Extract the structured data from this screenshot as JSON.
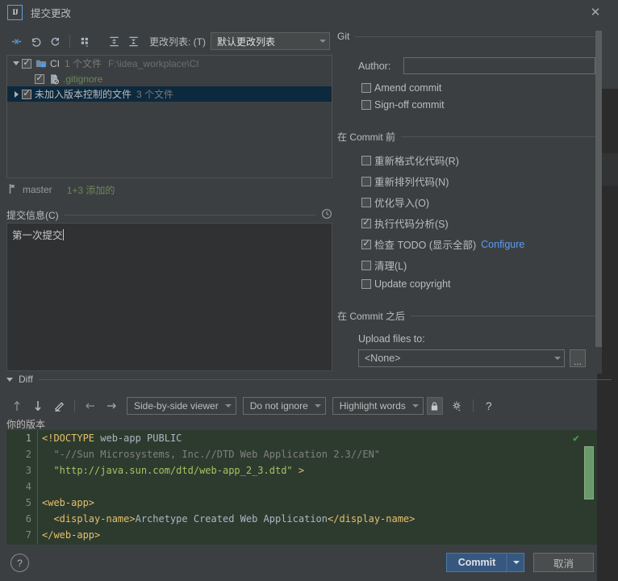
{
  "window": {
    "title": "提交更改",
    "logo_text": "IJ",
    "close_icon": "close-icon"
  },
  "changes_toolbar": {
    "buttons": [
      {
        "name": "show-diff-icon",
        "label": "Show Diff"
      },
      {
        "name": "revert-icon",
        "label": "Revert"
      },
      {
        "name": "refresh-icon",
        "label": "Refresh"
      },
      {
        "name": "group-by-icon",
        "label": "Group By"
      },
      {
        "name": "expand-all-icon",
        "label": "Expand All"
      },
      {
        "name": "collapse-all-icon",
        "label": "Collapse All"
      }
    ],
    "changelist_label": "更改列表: (T)",
    "changelist_value": "默认更改列表"
  },
  "file_tree": {
    "rows": [
      {
        "type": "folder",
        "twisty": "down",
        "checked": true,
        "icon": "folder-icon",
        "name": "CI",
        "sub": "1 个文件",
        "path": "F:\\idea_workplace\\CI",
        "selected": false,
        "indent": 0
      },
      {
        "type": "file",
        "twisty": "none",
        "checked": true,
        "icon": "gitignore-file-icon",
        "name": ".gitignore",
        "sub": "",
        "path": "",
        "selected": false,
        "indent": 1
      },
      {
        "type": "group",
        "twisty": "right",
        "checked": true,
        "icon": "none",
        "name": "未加入版本控制的文件",
        "sub": "3 个文件",
        "path": "",
        "selected": true,
        "indent": 0
      }
    ]
  },
  "branch": {
    "icon": "branch-icon",
    "name": "master",
    "stat": "1+3 添加的"
  },
  "commit_message": {
    "header": "提交信息(C)",
    "history_icon": "clock-icon",
    "value": "第一次提交"
  },
  "right_panel": {
    "git_section": "Git",
    "author_label": "Author:",
    "author_value": "",
    "git_checkboxes": [
      {
        "label": "Amend commit",
        "checked": false,
        "name": "amend-commit-checkbox"
      },
      {
        "label": "Sign-off commit",
        "checked": false,
        "name": "sign-off-commit-checkbox"
      }
    ],
    "before_commit_section": "在 Commit 前",
    "before_commit_checkboxes": [
      {
        "label": "重新格式化代码(R)",
        "checked": false,
        "name": "reformat-code-checkbox",
        "link": ""
      },
      {
        "label": "重新排列代码(N)",
        "checked": false,
        "name": "rearrange-code-checkbox",
        "link": ""
      },
      {
        "label": "优化导入(O)",
        "checked": false,
        "name": "optimize-imports-checkbox",
        "link": ""
      },
      {
        "label": "执行代码分析(S)",
        "checked": true,
        "name": "perform-code-analysis-checkbox",
        "link": ""
      },
      {
        "label": "检查 TODO (显示全部)",
        "checked": true,
        "name": "check-todo-checkbox",
        "link": "Configure"
      },
      {
        "label": "清理(L)",
        "checked": false,
        "name": "cleanup-checkbox",
        "link": ""
      },
      {
        "label": "Update copyright",
        "checked": false,
        "name": "update-copyright-checkbox",
        "link": ""
      }
    ],
    "after_commit_section": "在 Commit 之后",
    "upload_label": "Upload files to:",
    "upload_value": "<None>",
    "upload_browse": "..."
  },
  "diff": {
    "header": "Diff",
    "toolbar_buttons": [
      {
        "name": "previous-difference-icon",
        "label": "Previous Difference"
      },
      {
        "name": "next-difference-icon",
        "label": "Next Difference"
      },
      {
        "name": "edit-source-icon",
        "label": "Edit Source"
      },
      {
        "name": "apply-left-icon",
        "label": "Apply Left"
      },
      {
        "name": "apply-right-icon",
        "label": "Apply Right"
      }
    ],
    "viewer_mode": "Side-by-side viewer",
    "ignore_mode": "Do not ignore",
    "highlight_mode": "Highlight words",
    "lock_icon": "lock-icon",
    "settings_icon": "gear-icon",
    "help_icon": "question-mark-icon",
    "pane_label": "你的版本",
    "status_icon": "checkmark-icon",
    "code_lines": [
      {
        "num": "1",
        "segments": [
          {
            "t": "<!DOCTYPE ",
            "c": "tag"
          },
          {
            "t": "web-app PUBLIC",
            "c": "txt"
          }
        ]
      },
      {
        "num": "2",
        "segments": [
          {
            "t": "  \"-//Sun Microsystems, Inc.//DTD Web Application 2.3//EN\"",
            "c": "dim"
          }
        ]
      },
      {
        "num": "3",
        "segments": [
          {
            "t": "  \"http://java.sun.com/dtd/web-app_2_3.dtd\" ",
            "c": "str"
          },
          {
            "t": ">",
            "c": "tag"
          }
        ]
      },
      {
        "num": "4",
        "segments": [
          {
            "t": "",
            "c": "txt"
          }
        ]
      },
      {
        "num": "5",
        "segments": [
          {
            "t": "<web-app>",
            "c": "tag"
          }
        ]
      },
      {
        "num": "6",
        "segments": [
          {
            "t": "  <display-name>",
            "c": "tag"
          },
          {
            "t": "Archetype Created Web Application",
            "c": "txt"
          },
          {
            "t": "</display-name>",
            "c": "tag"
          }
        ]
      },
      {
        "num": "7",
        "segments": [
          {
            "t": "</web-app>",
            "c": "tag"
          }
        ]
      }
    ]
  },
  "footer": {
    "help_label": "?",
    "commit_label": "Commit",
    "commit_dropdown_icon": "chevron-down-icon",
    "cancel_label": "取消"
  },
  "colors": {
    "dialog_bg": "#3c3f41",
    "accent_blue": "#365880",
    "link_blue": "#589df6",
    "added_green": "#6a8759",
    "selection_blue": "#0d293e",
    "diff_bg": "#2d3b2f"
  }
}
